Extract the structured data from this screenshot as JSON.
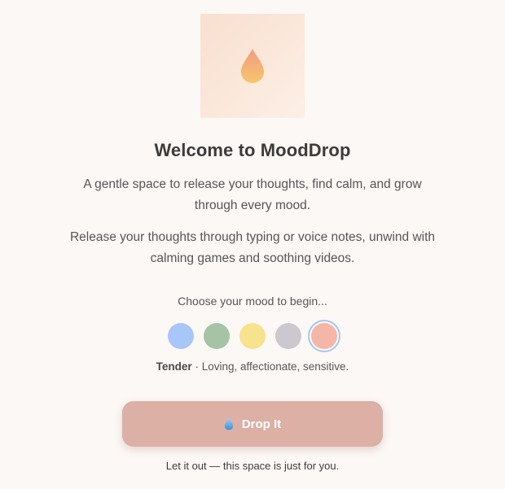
{
  "hero": {
    "icon": "water-drop-icon",
    "drop_colors": [
      "#f5a582",
      "#f6c36a"
    ]
  },
  "welcome": {
    "title": "Welcome to MoodDrop",
    "subtitle": "A gentle space to release your thoughts, find calm, and grow through every mood.",
    "description": "Release your thoughts through typing or voice notes, unwind with calming games and soothing videos."
  },
  "mood_picker": {
    "prompt": "Choose your mood to begin...",
    "options": [
      {
        "color": "#a8c6f7"
      },
      {
        "color": "#a6c4a4"
      },
      {
        "color": "#f7e28e"
      },
      {
        "color": "#cbc8d2"
      },
      {
        "color": "#f4b6a6",
        "selected": true
      }
    ],
    "selected_name": "Tender",
    "selected_separator": " · ",
    "selected_description": "Loving, affectionate, sensitive."
  },
  "action": {
    "button_label": "Drop It",
    "button_icon": "water-drop-icon",
    "button_color": "#dcb0a5",
    "footnote": "Let it out — this space is just for you."
  }
}
